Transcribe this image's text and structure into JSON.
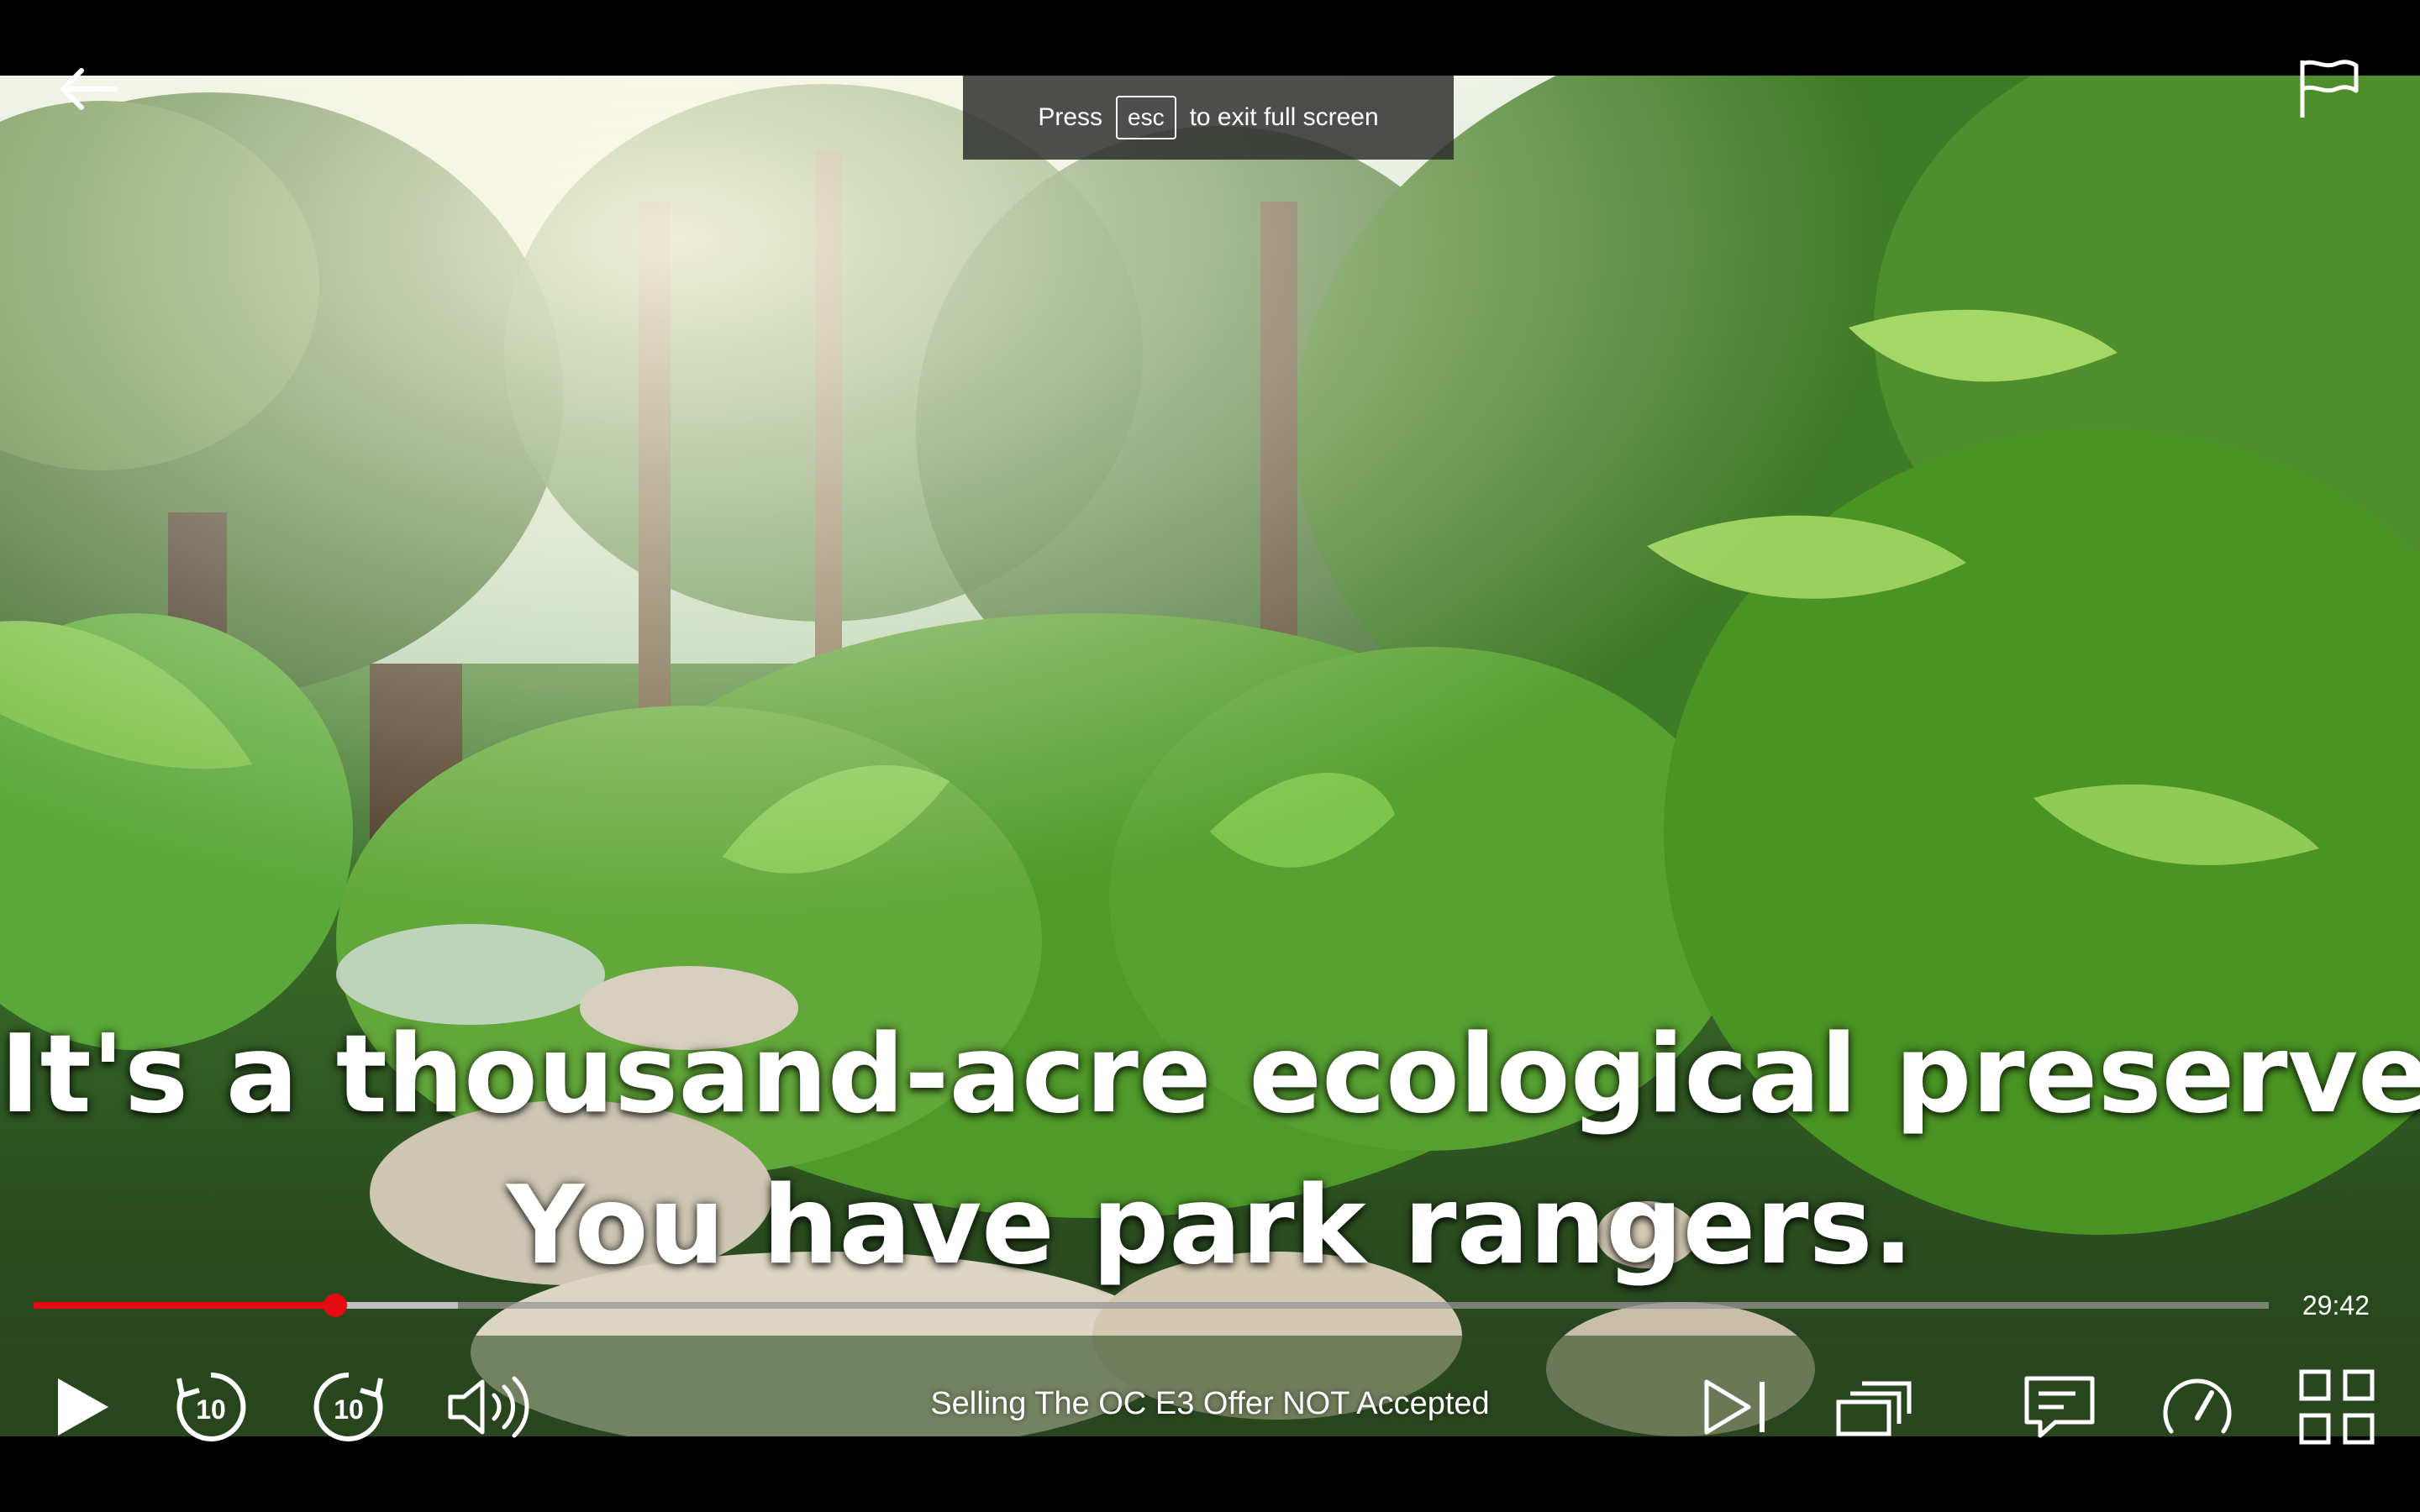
{
  "esc_banner": {
    "prefix": "Press",
    "key": "esc",
    "suffix": "to exit full screen"
  },
  "subtitles": {
    "line1": "It's a thousand-acre ecological preserve.",
    "line2": "You have park rangers."
  },
  "playback": {
    "progress_fraction": 0.135,
    "buffered_fraction": 0.19,
    "time_remaining": "29:42"
  },
  "controls": {
    "episode_title": "Selling The OC E3  Offer NOT Accepted",
    "rewind_seconds": "10",
    "forward_seconds": "10"
  },
  "icons": {
    "back": "arrow-left-icon",
    "report": "flag-icon",
    "play": "play-icon",
    "rewind": "rewind-10-icon",
    "forward": "forward-10-icon",
    "volume": "volume-icon",
    "next_episode": "next-episode-icon",
    "episodes": "episodes-icon",
    "subtitles": "subtitles-icon",
    "speed": "speed-icon",
    "fullscreen": "exit-fullscreen-icon"
  },
  "colors": {
    "accent": "#e50914",
    "text": "#ffffff"
  }
}
